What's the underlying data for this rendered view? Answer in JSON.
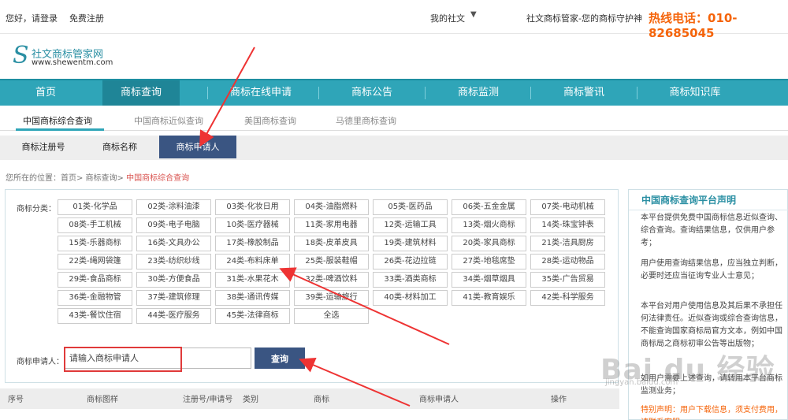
{
  "topbar": {
    "greeting": "您好，请登录",
    "register": "免费注册",
    "my_label": "我的社文",
    "slogan": "社文商标管家-您的商标守护神",
    "hotline": "热线电话：010-82685045"
  },
  "logo": {
    "name": "社文商标管家网",
    "url": "www.shewentm.com"
  },
  "nav": {
    "items": [
      "首页",
      "商标查询",
      "商标在线申请",
      "商标公告",
      "商标监测",
      "商标警讯",
      "商标知识库"
    ]
  },
  "subtabs": [
    "中国商标综合查询",
    "中国商标近似查询",
    "美国商标查询",
    "马德里商标查询"
  ],
  "qtabs": [
    "商标注册号",
    "商标名称",
    "商标申请人"
  ],
  "breadcrumb": {
    "prefix": "您所在的位置：首页> 商标查询> ",
    "current": "中国商标综合查询"
  },
  "form": {
    "category_label": "商标分类：",
    "categories": [
      "01类-化学品",
      "02类-涂料油漆",
      "03类-化妆日用",
      "04类-油脂燃料",
      "05类-医药品",
      "06类-五金金属",
      "07类-电动机械",
      "08类-手工机械",
      "09类-电子电脑",
      "10类-医疗器械",
      "11类-家用电器",
      "12类-运输工具",
      "13类-烟火商标",
      "14类-珠宝钟表",
      "15类-乐器商标",
      "16类-文具办公",
      "17类-橡胶制品",
      "18类-皮革皮具",
      "19类-建筑材料",
      "20类-家具商标",
      "21类-洁具厨房",
      "22类-绳网袋篷",
      "23类-纺织纱线",
      "24类-布料床单",
      "25类-服装鞋帽",
      "26类-花边拉链",
      "27类-地毯席垫",
      "28类-运动物品",
      "29类-食品商标",
      "30类-方便食品",
      "31类-水果花木",
      "32类-啤酒饮料",
      "33类-酒类商标",
      "34类-烟草烟具",
      "35类-广告贸易",
      "36类-金融物管",
      "37类-建筑修理",
      "38类-通讯传媒",
      "39类-运输旅行",
      "40类-材料加工",
      "41类-教育娱乐",
      "42类-科学服务",
      "43类-餐饮住宿",
      "44类-医疗服务",
      "45类-法律商标",
      "全选"
    ],
    "applicant_label": "商标申请人：",
    "applicant_placeholder": "请输入商标申请人",
    "search_label": "查询"
  },
  "table": {
    "headers": [
      "序号",
      "商标图样",
      "注册号/申请号",
      "类别",
      "商标",
      "商标申请人",
      "操作"
    ]
  },
  "sidebar": {
    "title": "中国商标查询平台声明",
    "p1": "本平台提供免费中国商标信息近似查询、综合查询。查询结果信息，仅供用户参考；",
    "p2": "用户使用查询结果信息，应当独立判断，必要时还应当征询专业人士意见；",
    "p3": "本平台对用户使用信息及其后果不承担任何法律责任。近似查询或综合查询信息，不能查询国家商标局官方文本，例如中国商标局之商标初审公告等出版物；",
    "p4": "如用户需要上述查询，请转用本平台商标监测业务；",
    "p5": "特别声明：用户下载信息，须支付费用，请联系客服。"
  },
  "watermark": {
    "text": "Bai du 经验",
    "sub": "jingyan.baidu.com"
  }
}
